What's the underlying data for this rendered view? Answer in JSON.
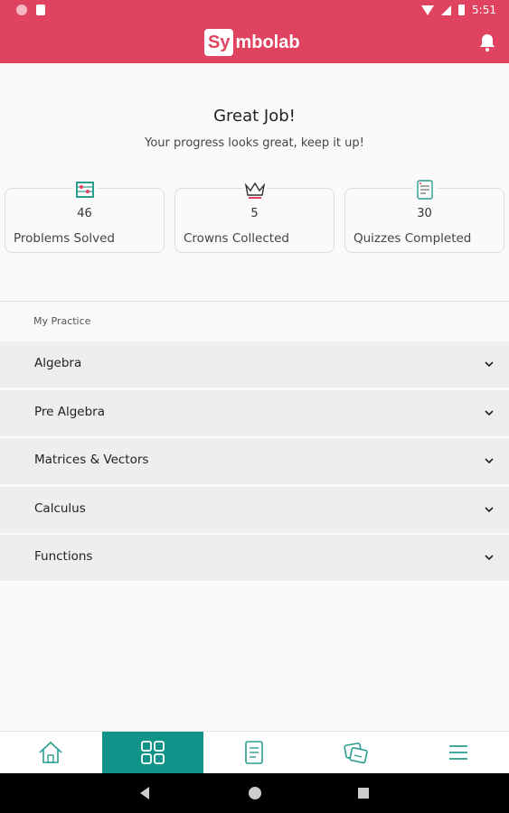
{
  "status_bar": {
    "time": "5:51"
  },
  "app": {
    "logo_badge": "Sy",
    "logo_rest": "mbolab"
  },
  "hero": {
    "title": "Great Job!",
    "subtitle": "Your progress looks great, keep it up!"
  },
  "stats": [
    {
      "icon": "abacus-icon",
      "value": "46",
      "label": "Problems Solved"
    },
    {
      "icon": "crown-icon",
      "value": "5",
      "label": "Crowns Collected"
    },
    {
      "icon": "quiz-sheet-icon",
      "value": "30",
      "label": "Quizzes Completed"
    }
  ],
  "practice": {
    "heading": "My Practice",
    "items": [
      {
        "label": "Algebra"
      },
      {
        "label": "Pre Algebra"
      },
      {
        "label": "Matrices & Vectors"
      },
      {
        "label": "Calculus"
      },
      {
        "label": "Functions"
      }
    ]
  },
  "bottom_nav": [
    {
      "icon": "home-icon",
      "active": false
    },
    {
      "icon": "grid-icon",
      "active": true
    },
    {
      "icon": "notebook-icon",
      "active": false
    },
    {
      "icon": "cards-icon",
      "active": false
    },
    {
      "icon": "menu-icon",
      "active": false
    }
  ],
  "colors": {
    "brand": "#e0435f",
    "accent": "#12938a",
    "icon": "#2a9d8f"
  }
}
